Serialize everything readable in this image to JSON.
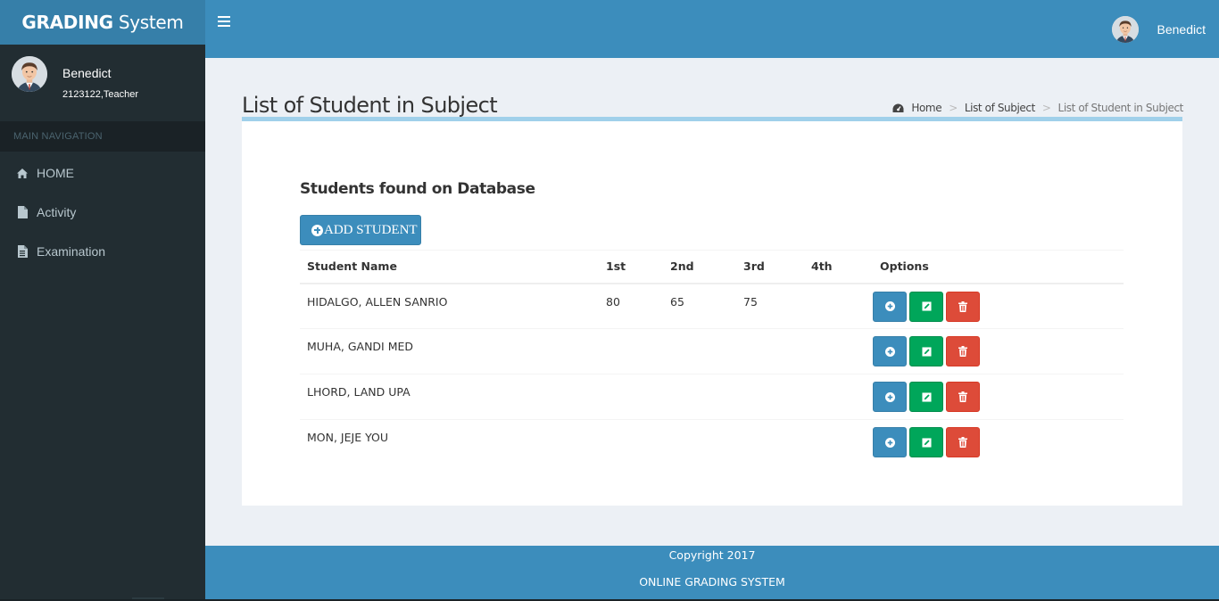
{
  "app": {
    "logo_bold": "GRADING",
    "logo_rest": " System"
  },
  "navbar": {
    "user_name": "Benedict",
    "toggle_icon": "hamburger-icon"
  },
  "sidebar": {
    "user": {
      "name": "Benedict",
      "role": "2123122,Teacher"
    },
    "header": "MAIN NAVIGATION",
    "items": [
      {
        "label": "HOME",
        "icon": "home-icon"
      },
      {
        "label": "Activity",
        "icon": "file-icon"
      },
      {
        "label": "Examination",
        "icon": "file-text-icon"
      }
    ]
  },
  "page": {
    "title": "List of Student in Subject",
    "breadcrumb": {
      "home": "Home",
      "subjects": "List of Subject",
      "current": "List of Student in Subject"
    }
  },
  "box": {
    "subtitle": "Students found on Database",
    "add_button": "ADD STUDENT"
  },
  "table": {
    "headers": {
      "name": "Student Name",
      "q1": "1st",
      "q2": "2nd",
      "q3": "3rd",
      "q4": "4th",
      "options": "Options"
    },
    "rows": [
      {
        "name": "HIDALGO, ALLEN SANRIO",
        "q1": "80",
        "q2": "65",
        "q3": "75",
        "q4": ""
      },
      {
        "name": "MUHA, GANDI MED",
        "q1": "",
        "q2": "",
        "q3": "",
        "q4": ""
      },
      {
        "name": "LHORD, LAND UPA",
        "q1": "",
        "q2": "",
        "q3": "",
        "q4": ""
      },
      {
        "name": "MON, JEJE YOU",
        "q1": "",
        "q2": "",
        "q3": "",
        "q4": ""
      }
    ]
  },
  "footer": {
    "copyright": "Copyright 2017",
    "system": "ONLINE GRADING SYSTEM"
  },
  "colors": {
    "primary": "#3c8dbc",
    "success": "#00a65a",
    "danger": "#dd4b39",
    "sidebar": "#222d32"
  }
}
